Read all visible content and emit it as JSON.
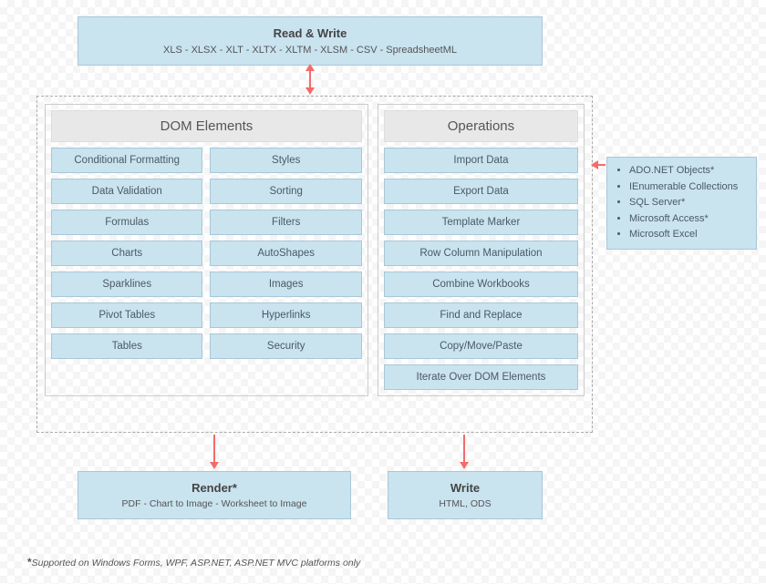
{
  "top": {
    "title": "Read & Write",
    "subtitle": "XLS - XLSX - XLT - XLTX - XLTM - XLSM - CSV -  SpreadsheetML"
  },
  "dom": {
    "header": "DOM Elements",
    "col1": [
      "Conditional Formatting",
      "Data Validation",
      "Formulas",
      "Charts",
      "Sparklines",
      "Pivot Tables",
      "Tables"
    ],
    "col2": [
      "Styles",
      "Sorting",
      "Filters",
      "AutoShapes",
      "Images",
      "Hyperlinks",
      "Security"
    ]
  },
  "ops": {
    "header": "Operations",
    "items": [
      "Import Data",
      "Export Data",
      "Template Marker",
      "Row Column Manipulation",
      "Combine Workbooks",
      "Find and Replace",
      "Copy/Move/Paste",
      "Iterate Over DOM Elements"
    ]
  },
  "side": {
    "items": [
      "ADO.NET Objects*",
      "IEnumerable Collections",
      "SQL Server*",
      "Microsoft Access*",
      "Microsoft Excel"
    ]
  },
  "render": {
    "title": "Render*",
    "subtitle": "PDF - Chart to Image - Worksheet to Image"
  },
  "write": {
    "title": "Write",
    "subtitle": "HTML, ODS"
  },
  "footnote": {
    "star": "*",
    "text": "Supported on Windows Forms, WPF, ASP.NET, ASP.NET MVC platforms only"
  }
}
